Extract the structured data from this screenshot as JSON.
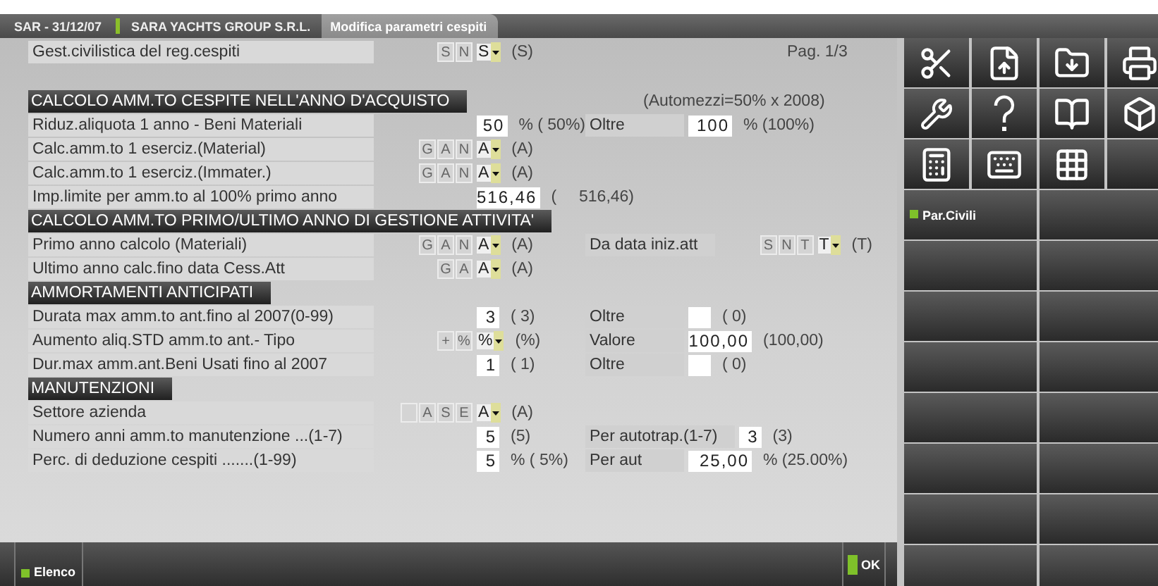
{
  "tabs": [
    {
      "label": "SAR - 31/12/07",
      "selected": false
    },
    {
      "label": "SARA YACHTS GROUP S.R.L.",
      "selected": false
    },
    {
      "label": "Modifica parametri cespiti",
      "selected": true
    }
  ],
  "top_row": {
    "label": "Gest.civilistica del reg.cespiti",
    "control": {
      "kind": "choice",
      "options": [
        "S",
        "N"
      ],
      "value": "S",
      "default": "(S)"
    }
  },
  "page": "Pag. 1/3",
  "sections": [
    {
      "title": "CALCOLO AMM.TO CESPITE NELL'ANNO D'ACQUISTO",
      "note": "(Automezzi=50% x 2008)",
      "rows": [
        {
          "label": "Riduz.aliquota 1 anno - Beni Materiali",
          "control": {
            "kind": "number",
            "value": "50",
            "after": "% ( 50%)"
          },
          "extra": {
            "label": "Oltre",
            "control": {
              "kind": "number",
              "value": "100",
              "after": "% (100%)"
            }
          }
        },
        {
          "label": "Calc.amm.to 1 esercіz.(Material)",
          "control": {
            "kind": "choice",
            "options": [
              "G",
              "A",
              "N"
            ],
            "value": "A",
            "default": "(A)"
          }
        },
        {
          "label": "Calc.amm.to 1 esercіz.(Immater.)",
          "control": {
            "kind": "choice",
            "options": [
              "G",
              "A",
              "N"
            ],
            "value": "A",
            "default": "(A)"
          }
        },
        {
          "label": "Imp.limite per amm.to al 100% primo anno",
          "control": {
            "kind": "amount",
            "value": "516,46",
            "after": "(     516,46)"
          }
        }
      ]
    },
    {
      "title": "CALCOLO AMM.TO PRIMO/ULTIMO ANNO DI GESTIONE ATTIVITA'",
      "rows": [
        {
          "label": "Primo anno calcolo (Materiali)",
          "control": {
            "kind": "choice",
            "options": [
              "G",
              "A",
              "N"
            ],
            "value": "A",
            "default": "(A)"
          },
          "extra": {
            "label": "Da data iniz.att",
            "control": {
              "kind": "choice",
              "options": [
                "S",
                "N",
                "T"
              ],
              "value": "T",
              "default": "(T)"
            }
          }
        },
        {
          "label": "Ultimo anno calc.fino data Cess.Att",
          "control": {
            "kind": "choice",
            "options": [
              "G",
              "A"
            ],
            "value": "A",
            "default": "(A)"
          }
        }
      ]
    },
    {
      "title": "AMMORTAMENTI ANTICIPATI",
      "rows": [
        {
          "label": "Durata max amm.to ant.fino al 2007(0-99)",
          "control": {
            "kind": "number",
            "value": "3",
            "after": "( 3)"
          },
          "extra": {
            "label": "Oltre",
            "control": {
              "kind": "number",
              "after": "( 0)"
            }
          }
        },
        {
          "label": "Aumento aliq.STD amm.to ant.- Tipo",
          "control": {
            "kind": "choice",
            "options": [
              "+",
              "%"
            ],
            "value": "%",
            "default": "(%)"
          },
          "extra": {
            "label": "Valore",
            "control": {
              "kind": "decimal",
              "value": "100,00",
              "after": "(100,00)"
            }
          }
        },
        {
          "label": "Dur.max amm.ant.Beni Usati fino al 2007",
          "control": {
            "kind": "number",
            "value": "1",
            "after": "( 1)"
          },
          "extra": {
            "label": "Oltre",
            "control": {
              "kind": "number",
              "after": "( 0)"
            }
          }
        }
      ]
    },
    {
      "title": "MANUTENZIONI",
      "rows": [
        {
          "label": "Settore azienda",
          "control": {
            "kind": "choice",
            "blank_option": true,
            "options": [
              "A",
              "S",
              "E"
            ],
            "value": "A",
            "default": "(A)"
          }
        },
        {
          "label": "Numero anni amm.to manutenzione ...(1-7)",
          "control": {
            "kind": "number",
            "value": "5",
            "after": "(5)"
          },
          "extra": {
            "label": "Per autotrap.(1-7)",
            "control": {
              "kind": "number",
              "value": "3",
              "after": "(3)"
            }
          }
        },
        {
          "label": "Perc. di deduzione cespiti .......(1-99)",
          "control": {
            "kind": "number",
            "value": "5",
            "after": "% ( 5%)"
          },
          "extra": {
            "label": "Per aut",
            "control": {
              "kind": "decimal",
              "value": "25,00",
              "after": "% (25.00%)"
            }
          }
        }
      ]
    }
  ],
  "function_keys": [
    {
      "label": "Par.Civili"
    }
  ],
  "footer": {
    "left": "Elenco",
    "right": "OK"
  }
}
